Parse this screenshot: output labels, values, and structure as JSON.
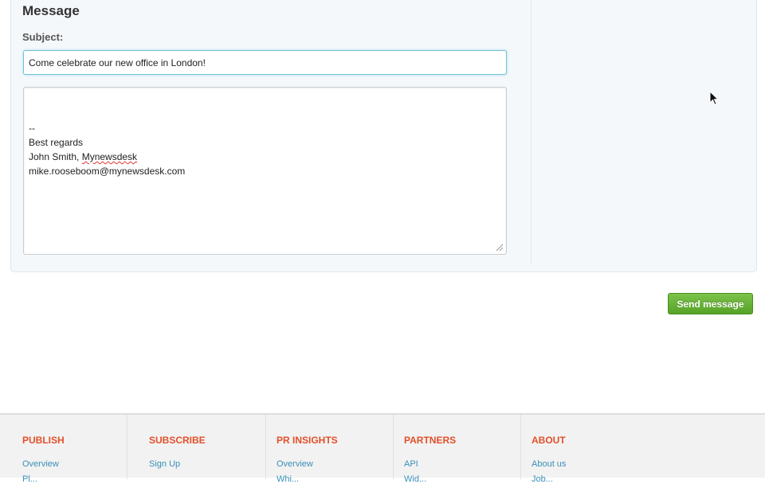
{
  "message": {
    "section_title": "Message",
    "subject_label": "Subject:",
    "subject_value": "Come celebrate our new office in London!",
    "body_lines": {
      "line1": "--",
      "line2": "Best regards",
      "line3_name": "John Smith, ",
      "line3_company": "Mynewsdesk",
      "line4": "mike.rooseboom@mynewsdesk.com"
    },
    "send_label": "Send message"
  },
  "colors": {
    "accent_orange": "#e2502a",
    "link_blue": "#3a90b8",
    "button_green": "#5fae2f"
  },
  "footer": {
    "columns": [
      {
        "heading": "PUBLISH",
        "link": "Overview",
        "link2": "Pl..."
      },
      {
        "heading": "SUBSCRIBE",
        "link": "Sign Up",
        "link2": ""
      },
      {
        "heading": "PR INSIGHTS",
        "link": "Overview",
        "link2": "Whi..."
      },
      {
        "heading": "PARTNERS",
        "link": "API",
        "link2": "Wid..."
      },
      {
        "heading": "ABOUT",
        "link": "About us",
        "link2": "Job..."
      }
    ]
  }
}
